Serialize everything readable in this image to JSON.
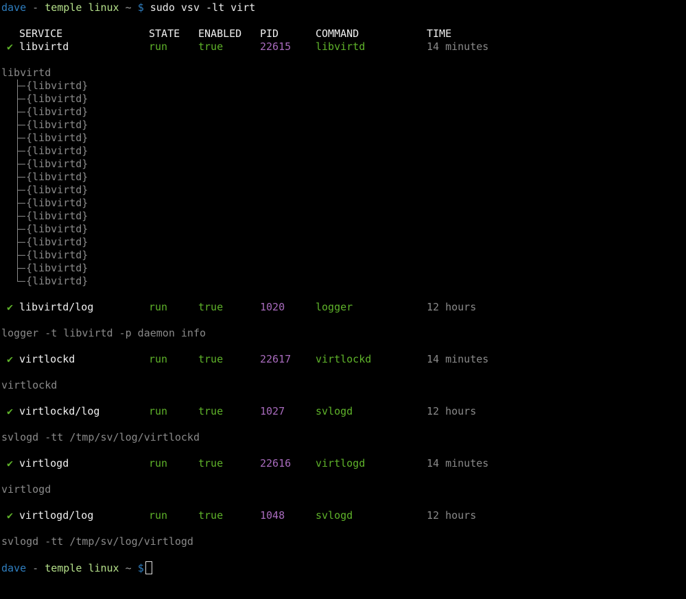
{
  "prompt": {
    "user": "dave",
    "sep": " - ",
    "host": "temple",
    "os": "linux",
    "path": "~",
    "symbol": "$"
  },
  "command": "sudo vsv -lt virt",
  "headers": {
    "service": "SERVICE",
    "state": "STATE",
    "enabled": "ENABLED",
    "pid": "PID",
    "command": "COMMAND",
    "time": "TIME"
  },
  "check_glyph": "✔",
  "colors": {
    "user": "#2f7fc1",
    "host": "#b5e08a",
    "green": "#5fb32a",
    "purple": "#a86bbd",
    "gray": "#8a8a8a"
  },
  "services": [
    {
      "name": "libvirtd",
      "state": "run",
      "enabled": "true",
      "pid": "22615",
      "command": "libvirtd",
      "time": "14 minutes",
      "detail": "libvirtd",
      "tree": [
        "{libvirtd}",
        "{libvirtd}",
        "{libvirtd}",
        "{libvirtd}",
        "{libvirtd}",
        "{libvirtd}",
        "{libvirtd}",
        "{libvirtd}",
        "{libvirtd}",
        "{libvirtd}",
        "{libvirtd}",
        "{libvirtd}",
        "{libvirtd}",
        "{libvirtd}",
        "{libvirtd}",
        "{libvirtd}"
      ]
    },
    {
      "name": "libvirtd/log",
      "state": "run",
      "enabled": "true",
      "pid": "1020",
      "command": "logger",
      "time": "12 hours",
      "detail": "logger -t libvirtd -p daemon info",
      "tree": []
    },
    {
      "name": "virtlockd",
      "state": "run",
      "enabled": "true",
      "pid": "22617",
      "command": "virtlockd",
      "time": "14 minutes",
      "detail": "virtlockd",
      "tree": []
    },
    {
      "name": "virtlockd/log",
      "state": "run",
      "enabled": "true",
      "pid": "1027",
      "command": "svlogd",
      "time": "12 hours",
      "detail": "svlogd -tt /tmp/sv/log/virtlockd",
      "tree": []
    },
    {
      "name": "virtlogd",
      "state": "run",
      "enabled": "true",
      "pid": "22616",
      "command": "virtlogd",
      "time": "14 minutes",
      "detail": "virtlogd",
      "tree": []
    },
    {
      "name": "virtlogd/log",
      "state": "run",
      "enabled": "true",
      "pid": "1048",
      "command": "svlogd",
      "time": "12 hours",
      "detail": "svlogd -tt /tmp/sv/log/virtlogd",
      "tree": []
    }
  ]
}
